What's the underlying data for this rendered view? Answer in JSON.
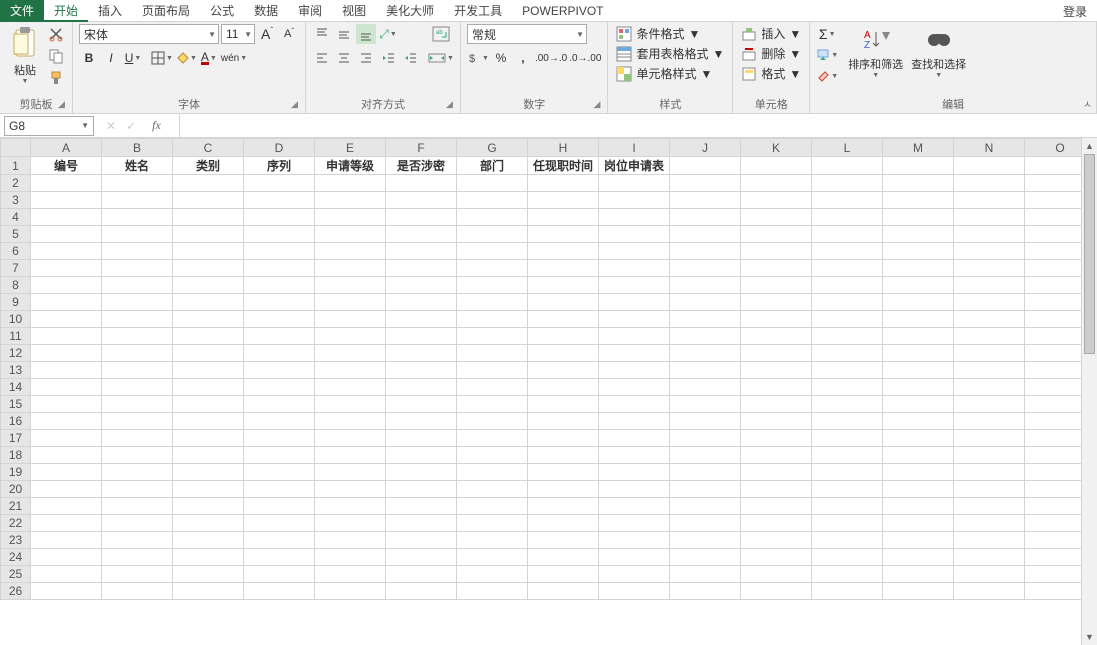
{
  "tabs": {
    "file": "文件",
    "items": [
      "开始",
      "插入",
      "页面布局",
      "公式",
      "数据",
      "审阅",
      "视图",
      "美化大师",
      "开发工具",
      "POWERPIVOT"
    ],
    "active_index": 0,
    "login": "登录"
  },
  "ribbon": {
    "clipboard": {
      "paste": "粘贴",
      "label": "剪贴板"
    },
    "font": {
      "name": "宋体",
      "size": "11",
      "label": "字体"
    },
    "align": {
      "label": "对齐方式"
    },
    "number": {
      "format": "常规",
      "label": "数字"
    },
    "styles": {
      "cond": "条件格式",
      "table": "套用表格格式",
      "cell": "单元格样式",
      "label": "样式"
    },
    "cells": {
      "insert": "插入",
      "delete": "删除",
      "format": "格式",
      "label": "单元格"
    },
    "editing": {
      "sort": "排序和筛选",
      "find": "查找和选择",
      "label": "编辑"
    }
  },
  "formula_bar": {
    "cell_ref": "G8",
    "value": ""
  },
  "sheet": {
    "columns": [
      "A",
      "B",
      "C",
      "D",
      "E",
      "F",
      "G",
      "H",
      "I",
      "J",
      "K",
      "L",
      "M",
      "N",
      "O"
    ],
    "row_count": 26,
    "headers_row1": [
      "编号",
      "姓名",
      "类别",
      "序列",
      "申请等级",
      "是否涉密",
      "部门",
      "任现职时间",
      "岗位申请表",
      "",
      "",
      "",
      "",
      "",
      ""
    ]
  }
}
